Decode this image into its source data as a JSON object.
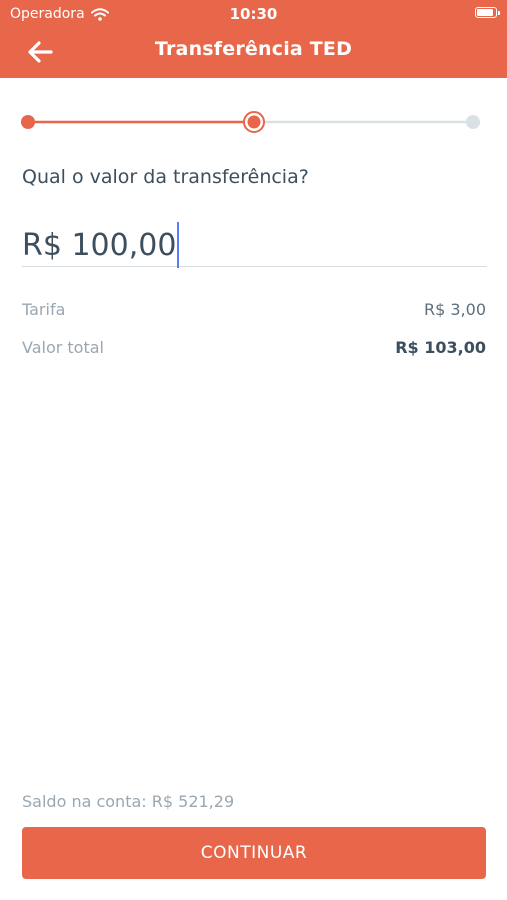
{
  "status_bar": {
    "carrier": "Operadora",
    "time": "10:30"
  },
  "header": {
    "title": "Transferência TED"
  },
  "stepper": {
    "total_steps": 3,
    "current_step": 2,
    "active_color": "#e8674b",
    "inactive_color": "#d9e1e5"
  },
  "form": {
    "question": "Qual o valor da transferência?",
    "amount": "R$ 100,00"
  },
  "summary": {
    "fee_label": "Tarifa",
    "fee_value": "R$ 3,00",
    "total_label": "Valor total",
    "total_value": "R$ 103,00"
  },
  "footer": {
    "balance": "Saldo na conta: R$ 521,29",
    "continue_label": "CONTINUAR"
  },
  "colors": {
    "brand": "#e8674b",
    "text": "#3d4f5e",
    "muted": "#9aa7b1",
    "caret": "#5b7bff"
  }
}
